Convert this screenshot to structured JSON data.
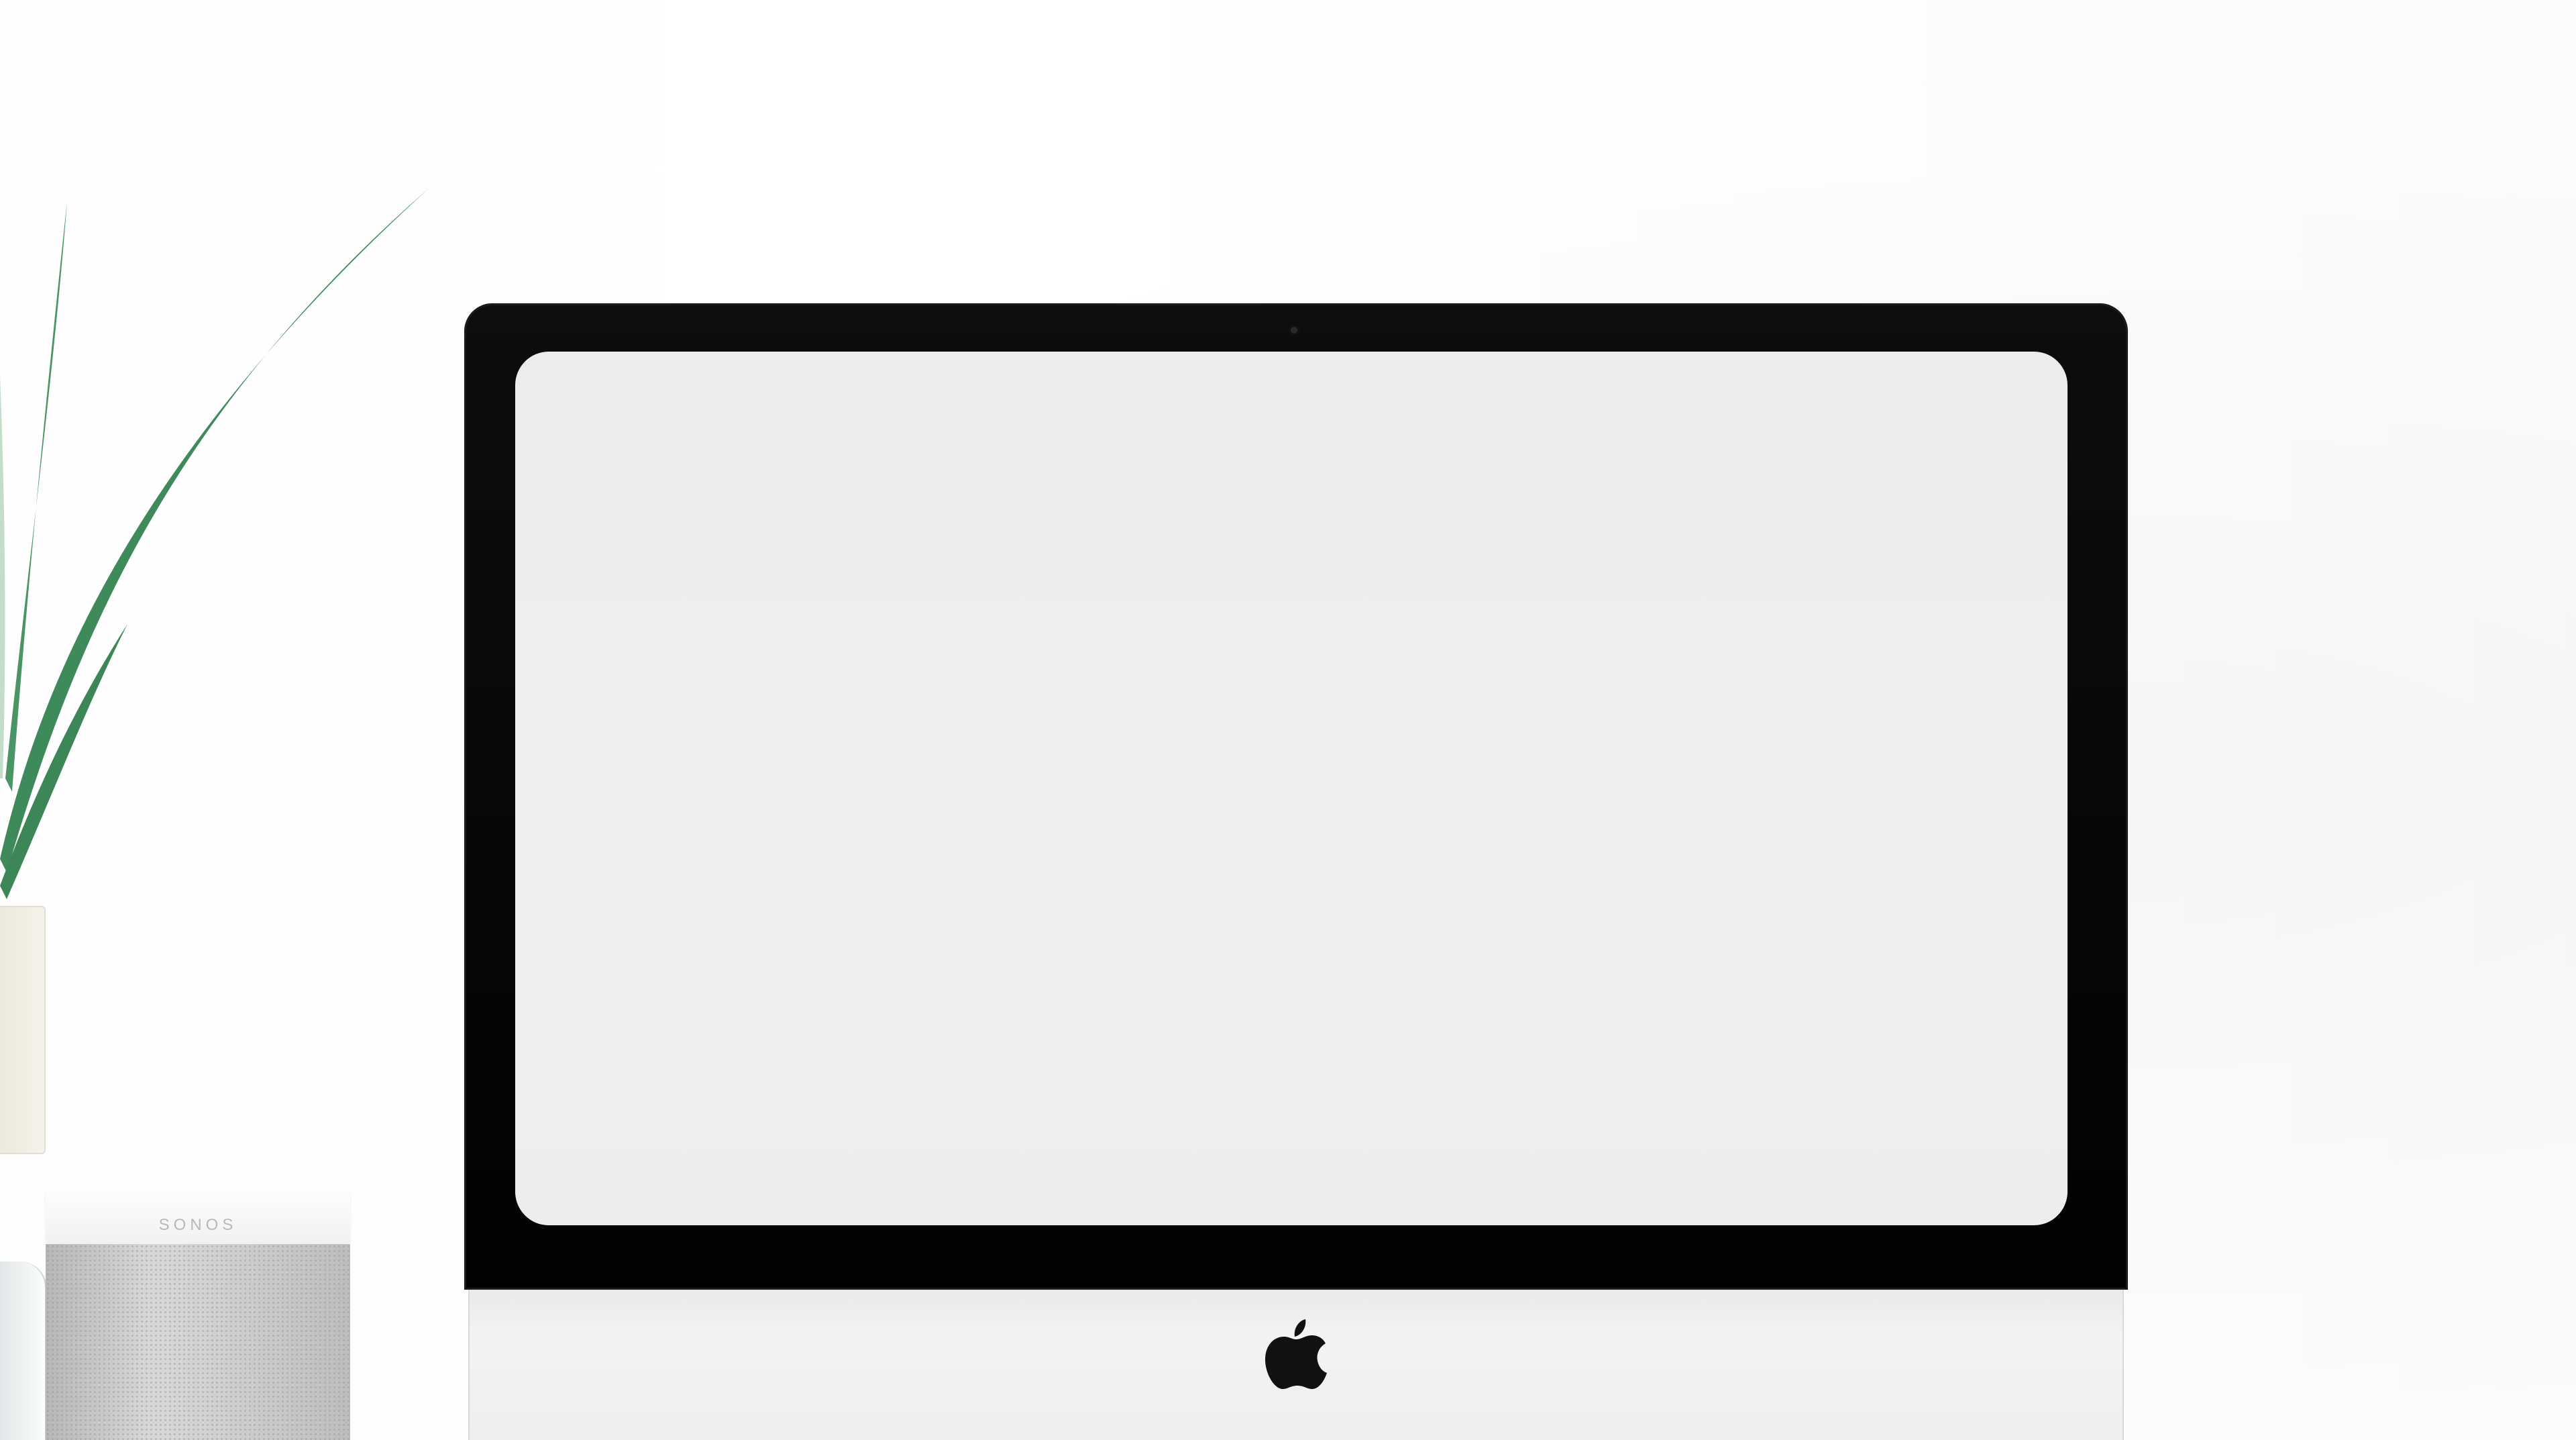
{
  "scene": {
    "speaker": {
      "brand_label": "SONOS"
    },
    "monitor": {
      "screen_color": "#ededed",
      "bezel_color": "#050505",
      "chin_color": "#efefef"
    },
    "icons": [
      "apple-logo-icon",
      "camera-icon"
    ],
    "colors": {
      "plant_green": "#3e8a5a",
      "speaker_grey": "#c9c9c9",
      "wall_white": "#fdfdfd"
    }
  }
}
